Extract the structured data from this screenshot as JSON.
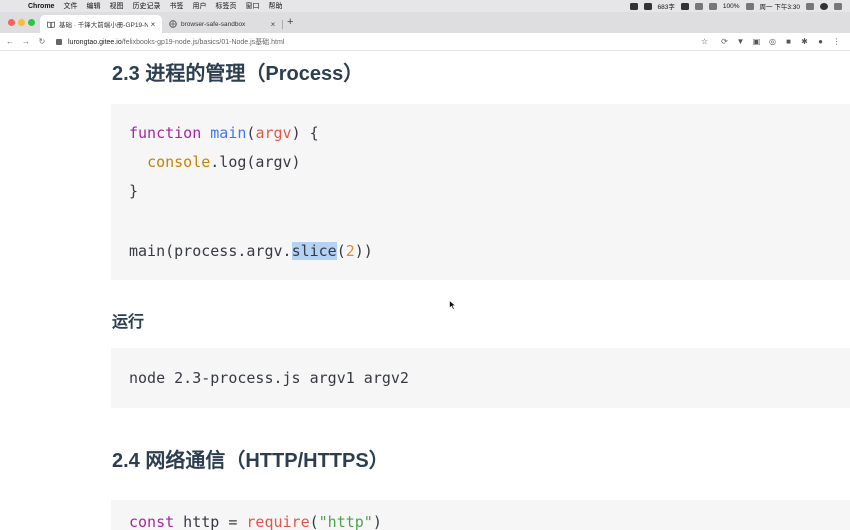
{
  "menubar": {
    "app": "Chrome",
    "items": [
      "文件",
      "编辑",
      "视图",
      "历史记录",
      "书签",
      "用户",
      "标签页",
      "窗口",
      "帮助"
    ],
    "word_count": "683字",
    "battery": "100%",
    "datetime": "周一 下午3:30"
  },
  "tabs": [
    {
      "title": "基础 · 千锋大前端小册-GP19-N",
      "active": true
    },
    {
      "title": "browser-safe-sandbox",
      "active": false
    }
  ],
  "address": {
    "host": "lurongtao.gitee.io",
    "path": "/felixbooks-gp19-node.js/basics/01-Node.js基础.html"
  },
  "page": {
    "heading_process": "2.3 进程的管理（Process）",
    "run_label": "运行",
    "run_command": "node 2.3-process.js argv1 argv2",
    "heading_http": "2.4 网络通信（HTTP/HTTPS）"
  },
  "code1": {
    "kw_function": "function",
    "fn_main": "main",
    "param_argv": "argv",
    "brace_open": ") {",
    "paren_open": "(",
    "obj_console": "console",
    "log_call": ".log(argv)",
    "brace_close": "}",
    "call_prefix": "main(process.argv.",
    "call_selected": "slice",
    "call_num": "2",
    "call_suffix": "))"
  },
  "code3": {
    "kw_const": "const",
    "var_part": " http = ",
    "fn_require": "require",
    "str_arg": "\"http\"",
    "close": ")"
  }
}
